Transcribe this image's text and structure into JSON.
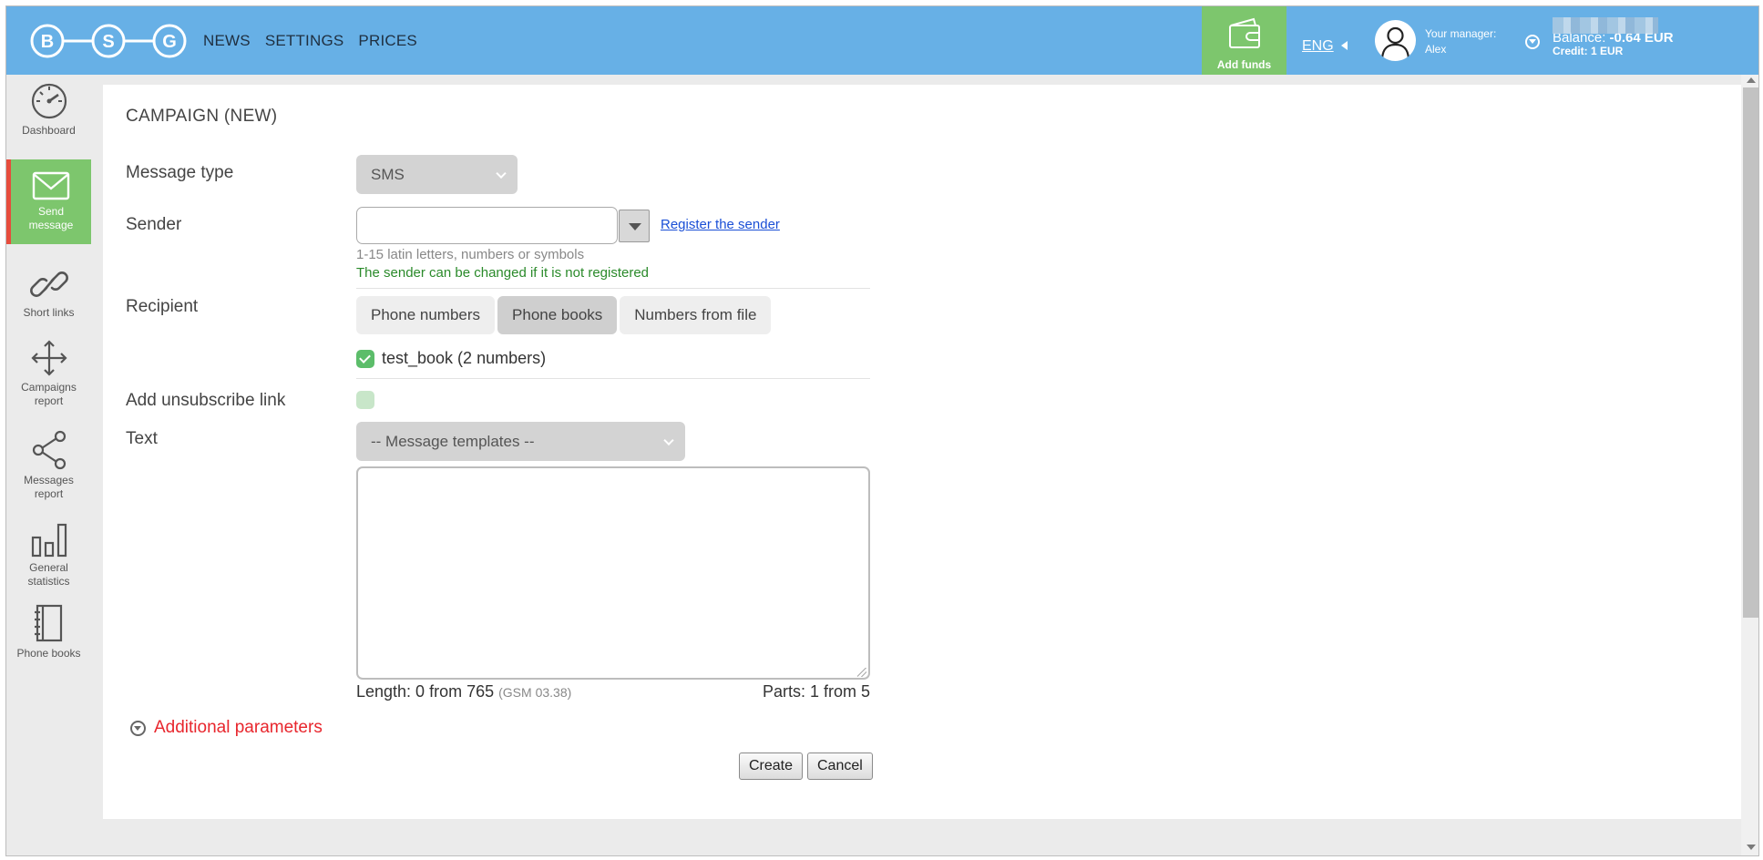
{
  "header": {
    "logo_letters": [
      "B",
      "S",
      "G"
    ],
    "nav": [
      "NEWS",
      "SETTINGS",
      "PRICES"
    ],
    "add_funds": "Add funds",
    "language": "ENG",
    "manager_label": "Your manager:",
    "manager_name": "Alex",
    "balance_label": "Balance:",
    "balance_value": "-0.64 EUR",
    "credit": "Credit: 1 EUR"
  },
  "sidebar": {
    "items": [
      {
        "label": "Dashboard",
        "icon": "speedometer-icon"
      },
      {
        "label": "Send message",
        "icon": "envelope-icon",
        "active": true
      },
      {
        "label": "Short links",
        "icon": "link-icon"
      },
      {
        "label": "Campaigns report",
        "icon": "move-arrows-icon"
      },
      {
        "label": "Messages report",
        "icon": "share-icon"
      },
      {
        "label": "General statistics",
        "icon": "bar-chart-icon"
      },
      {
        "label": "Phone books",
        "icon": "notebook-icon"
      }
    ]
  },
  "form": {
    "title": "CAMPAIGN (NEW)",
    "message_type_label": "Message type",
    "message_type_value": "SMS",
    "sender_label": "Sender",
    "sender_value": "",
    "register_link": "Register the sender",
    "sender_hint": "1-15 latin letters, numbers or symbols",
    "sender_note": "The sender can be changed if it is not registered",
    "recipient_label": "Recipient",
    "recipient_tabs": [
      {
        "label": "Phone numbers",
        "selected": false
      },
      {
        "label": "Phone books",
        "selected": true
      },
      {
        "label": "Numbers from file",
        "selected": false
      }
    ],
    "phone_book": "test_book (2 numbers)",
    "unsubscribe_label": "Add unsubscribe link",
    "text_label": "Text",
    "templates_value": "-- Message templates --",
    "text_value": "",
    "length_text": "Length: 0 from 765",
    "encoding": "(GSM 03.38)",
    "parts_text": "Parts: 1 from 5",
    "additional": "Additional parameters",
    "create_button": "Create",
    "cancel_button": "Cancel"
  },
  "colors": {
    "header_bg": "#67b0e6",
    "accent_green": "#7dc66d",
    "active_marker": "#e74c3c",
    "link_red": "#e8262d"
  }
}
